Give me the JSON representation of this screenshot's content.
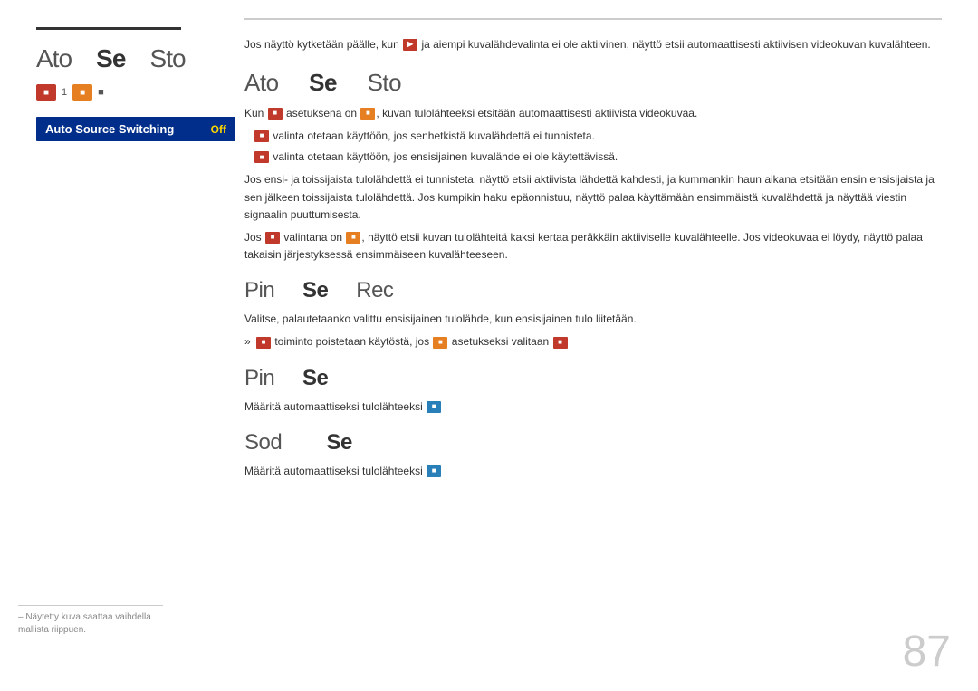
{
  "sidebar": {
    "title_part1": "Ato",
    "title_part2": "Se",
    "title_part3": "Sto",
    "menu_item": {
      "label": "Auto Source Switching",
      "value": "Off"
    },
    "footnote": "– Näytetty kuva saattaa vaihdella mallista riippuen."
  },
  "main": {
    "intro": "Jos näyttö kytketään päälle, kun          ja aiempi kuvalähdevalinta ei ole aktiivinen, näyttö etsii automaattisesti aktiivisen videokuvan kuvalähteen.",
    "section1": {
      "heading_p1": "Ato",
      "heading_p2": "Se",
      "heading_p3": "Sto",
      "para1": "Kun  asetuksena on                          , kuvan tulolähteeksi etsitään automaattisesti aktiivista videokuvaa.",
      "para2": "valinta otetaan käyttöön, jos senhetkistä kuvalähdettä ei tunnisteta.",
      "para3": "valinta otetaan käyttöön, jos ensisijainen kuvalähde ei ole käytettävissä.",
      "para4": "Jos ensi- ja toissijaista tulolähdettä ei tunnisteta, näyttö etsii aktiivista lähdettä kahdesti, ja kummankin haun aikana etsitään ensin ensisijaista ja sen jälkeen toissijaista tulolähdettä. Jos kumpikin haku epäonnistuu, näyttö palaa käyttämään ensimmäistä kuvalähdettä ja näyttää viestin signaalin puuttumisesta.",
      "para5": "Jos  valintana on              , näyttö etsii kuvan tulolähteitä kaksi kertaa peräkkäin aktiiviselle kuvalähteelle. Jos videokuvaa ei löydy, näyttö palaa takaisin järjestyksessä ensimmäiseen kuvalähteeseen."
    },
    "section2": {
      "heading_p1": "Pin",
      "heading_p2": "Se",
      "heading_p3": "Rec",
      "para1": "Valitse, palautetaanko valittu ensisijainen tulolähde, kun ensisijainen tulo liitetään.",
      "bullet1": "toiminto poistetaan käytöstä, jos  asetukseksi valitaan"
    },
    "section3": {
      "heading_p1": "Pin",
      "heading_p2": "Se",
      "para1": "Määritä automaattiseksi tulolähteeksi"
    },
    "section4": {
      "heading_p1": "Sod",
      "heading_p2": "Se",
      "para1": "Määritä automaattiseksi tulolähteeksi"
    },
    "page_number": "87"
  }
}
